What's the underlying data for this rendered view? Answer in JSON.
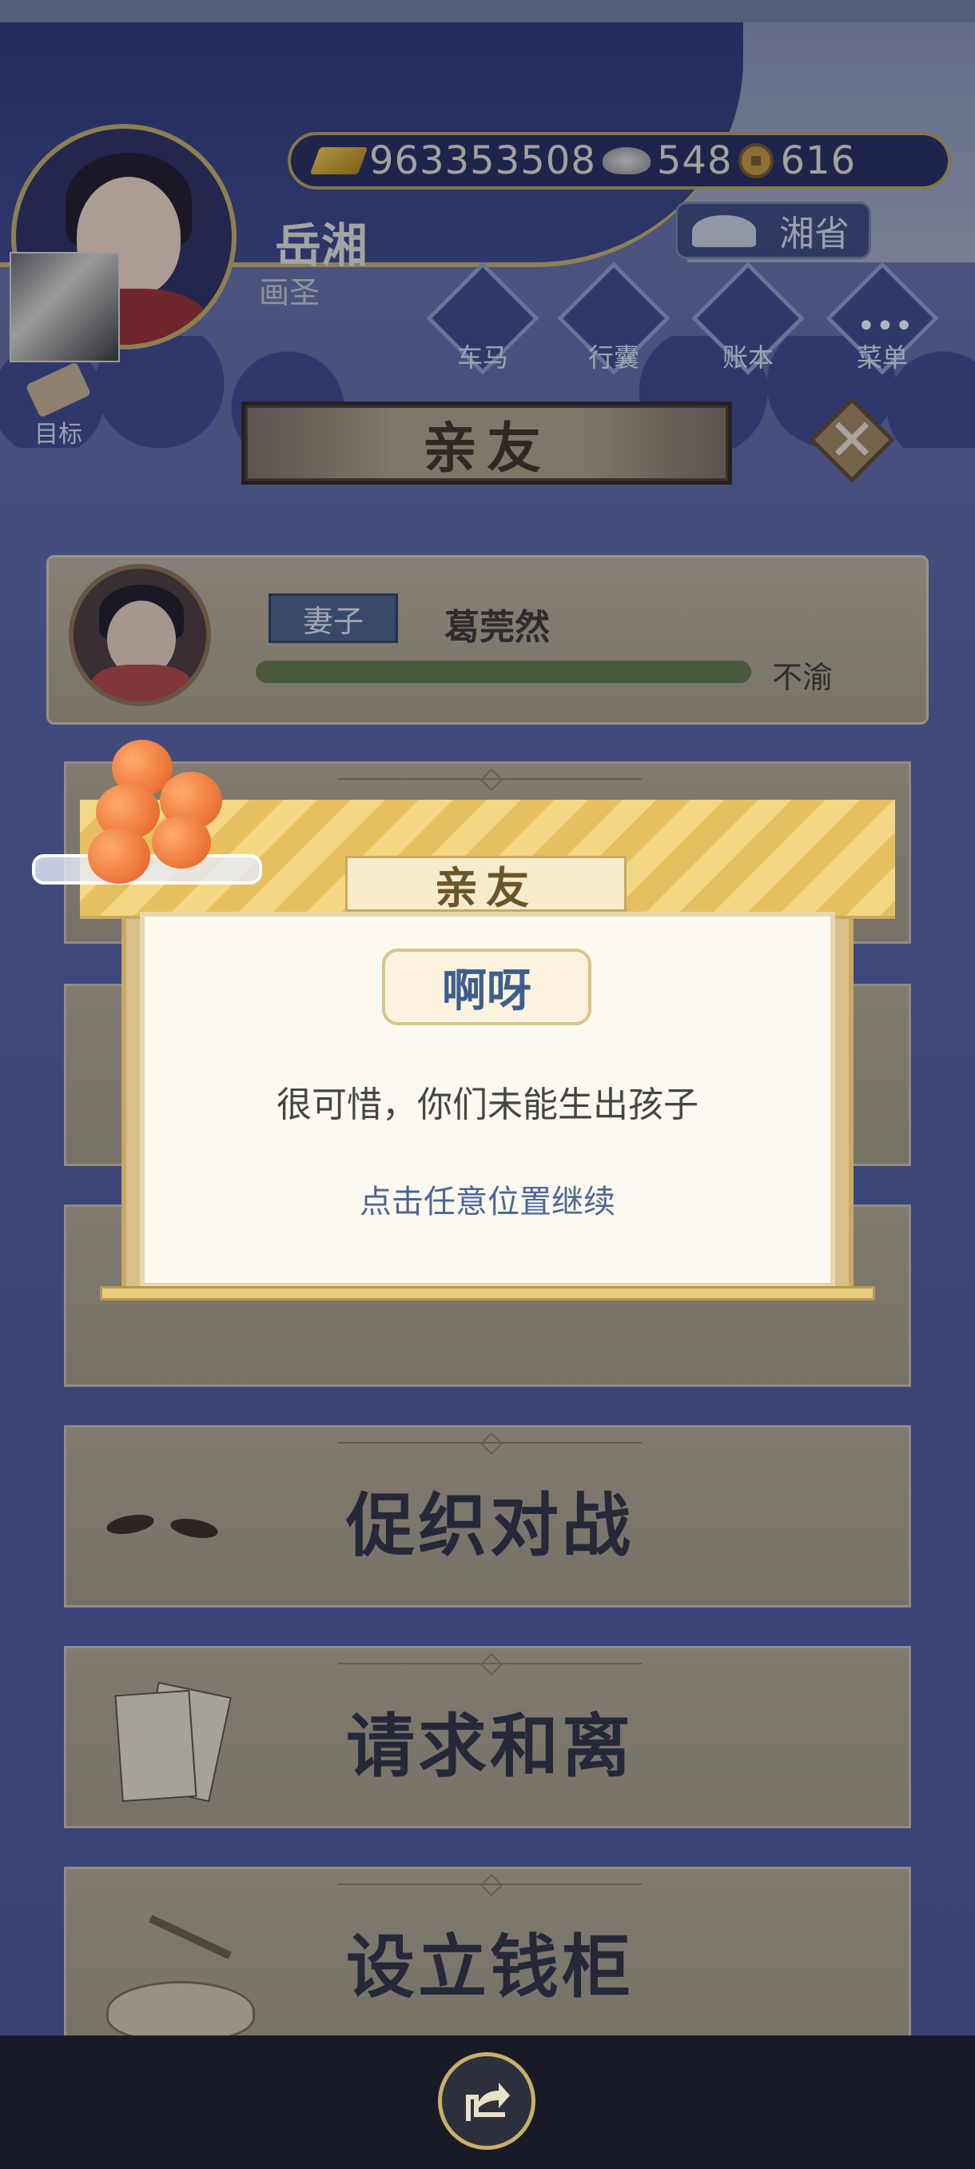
{
  "currency": {
    "gold": "963353508",
    "silver": "548",
    "copper": "616"
  },
  "player": {
    "name": "岳湘",
    "title": "画圣"
  },
  "province_label": "湘省",
  "nav_buttons": [
    {
      "label": "车马",
      "icon": "carriage-icon"
    },
    {
      "label": "行囊",
      "icon": "bag-icon"
    },
    {
      "label": "账本",
      "icon": "ledger-icon"
    },
    {
      "label": "菜单",
      "icon": "menu-icon"
    }
  ],
  "goal_label": "目标",
  "header_title": "亲友",
  "spouse": {
    "relation": "妻子",
    "name": "葛莞然",
    "mood": "不渝",
    "affection_fraction": 1.0
  },
  "options": [
    {
      "label": "",
      "icon": "hidden-icon"
    },
    {
      "label": "",
      "icon": "hidden-icon"
    },
    {
      "label": "",
      "icon": "hidden-icon"
    },
    {
      "label": "促织对战",
      "icon": "cricket-icon"
    },
    {
      "label": "请求和离",
      "icon": "divorce-letter-icon"
    },
    {
      "label": "设立钱柜",
      "icon": "key-hand-icon"
    }
  ],
  "dialog": {
    "tab": "亲友",
    "title": "啊呀",
    "message": "很可惜，你们未能生出孩子",
    "hint": "点击任意位置继续"
  },
  "colors": {
    "banner": "#2d3676",
    "gold_trim": "#c8b46a",
    "card": "#b5ab93",
    "dialog_bg": "#fcf9f1",
    "accent_blue": "#3f5d8c"
  }
}
